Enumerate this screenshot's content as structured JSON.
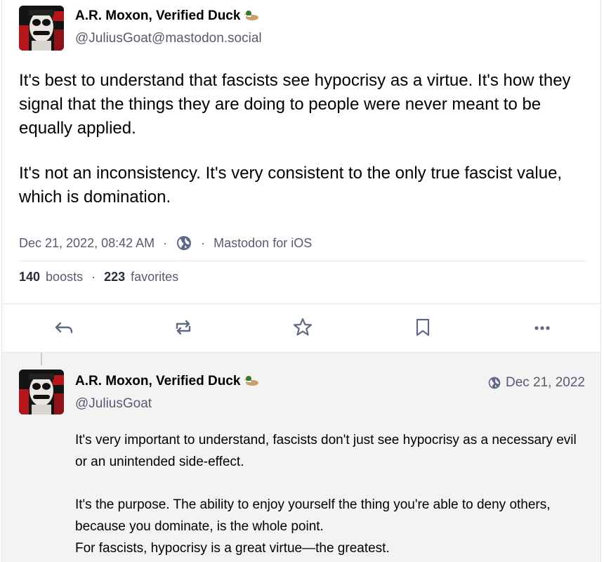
{
  "main_post": {
    "author_name": "A.R. Moxon, Verified Duck",
    "author_handle": "@JuliusGoat@mastodon.social",
    "paragraphs": [
      "It's best to understand that fascists see hypocrisy as a virtue. It's how they signal that the things they are doing to people were never meant to be equally applied.",
      "It's not an inconsistency. It's very consistent to the only true fascist value, which is domination."
    ],
    "timestamp": "Dec 21, 2022, 08:42 AM",
    "dot": "·",
    "visibility_icon": "globe-icon",
    "app": "Mastodon for iOS",
    "boosts_count": "140",
    "boosts_label": "boosts",
    "favorites_count": "223",
    "favorites_label": "favorites"
  },
  "actions": [
    "reply-icon",
    "boost-icon",
    "favorite-icon",
    "bookmark-icon",
    "more-icon"
  ],
  "reply_post": {
    "author_name": "A.R. Moxon, Verified Duck",
    "author_handle": "@JuliusGoat",
    "date": "Dec 21, 2022",
    "paragraph_1": "It's very important to understand, fascists don't just see hypocrisy as a necessary evil or an unintended side-effect.",
    "paragraph_2": "It's the purpose. The ability to enjoy yourself the thing you're able to deny others, because you dominate, is the whole point.",
    "paragraph_3": "For fascists, hypocrisy is a great virtue—the greatest."
  },
  "colors": {
    "muted_text": "#575b6e",
    "icon": "#606984",
    "border": "#e2e5ee",
    "reply_bg": "#f3f3f4"
  }
}
